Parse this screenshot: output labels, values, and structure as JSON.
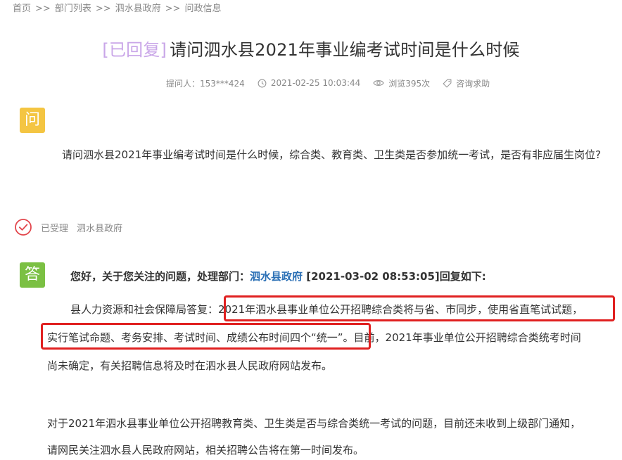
{
  "breadcrumb": {
    "items": [
      "首页",
      "部门列表",
      "泗水县政府",
      "问政信息"
    ],
    "separator": ">>"
  },
  "title": {
    "status": "[已回复]",
    "text": "请问泗水县2021年事业编考试时间是什么时候"
  },
  "meta": {
    "asker": "提问人：153***424",
    "time": "2021-02-25 10:03:44",
    "views": "浏览395次",
    "help": "咨询求助"
  },
  "question": {
    "badge": "问",
    "text": "请问泗水县2021年事业编考试时间是什么时候，综合类、教育类、卫生类是否参加统一考试，是否有非应届生岗位?"
  },
  "status_row": {
    "state": "已受理",
    "department": "泗水县政府"
  },
  "answer": {
    "badge": "答",
    "head_prefix": "您好，关于您关注的问题，处理部门：",
    "head_dept": "泗水县政府",
    "head_suffix": "[2021-03-02 08:53:05]回复如下:",
    "lines": [
      "县人力资源和社会保障局答复：2021年泗水县事业单位公开招聘综合类将与省、市同步，使用省直笔试试题，",
      "实行笔试命题、考务安排、考试时间、成绩公布时间四个“统一”。目前，2021年事业单位公开招聘综合类统考时间",
      "尚未确定，有关招聘信息将及时在泗水县人民政府网站发布。",
      "对于2021年泗水县事业单位公开招聘教育类、卫生类是否与综合类统一考试的问题，目前还未收到上级部门通知，",
      "请网民关注泗水县人民政府网站，相关招聘公告将在第一时间发布。"
    ]
  },
  "colors": {
    "status": "#c9a6e8",
    "question_badge": "#f4c542",
    "answer_badge": "#7bc043",
    "link": "#2a6fb5",
    "highlight": "#e02020"
  }
}
